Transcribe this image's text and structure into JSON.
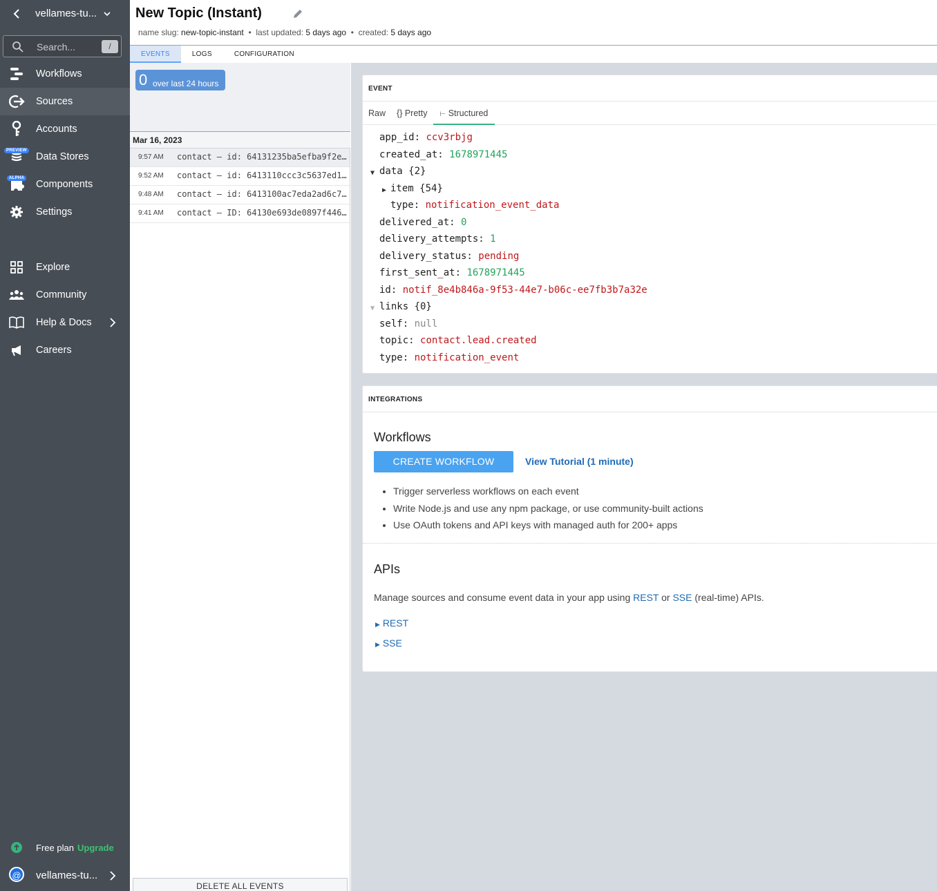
{
  "workspace": {
    "name": "vellames-tu..."
  },
  "search": {
    "placeholder": "Search...",
    "shortcut": "/"
  },
  "sidebar": {
    "items": [
      {
        "label": "Workflows",
        "icon": "workflows-icon"
      },
      {
        "label": "Sources",
        "icon": "sources-icon",
        "active": true
      },
      {
        "label": "Accounts",
        "icon": "key-icon"
      },
      {
        "label": "Data Stores",
        "icon": "database-icon",
        "badge": "PREVIEW"
      },
      {
        "label": "Components",
        "icon": "puzzle-icon",
        "badge": "ALPHA"
      },
      {
        "label": "Settings",
        "icon": "gear-icon"
      },
      {
        "label": "Explore",
        "icon": "grid-icon"
      },
      {
        "label": "Community",
        "icon": "people-icon"
      },
      {
        "label": "Help & Docs",
        "icon": "book-icon"
      },
      {
        "label": "Careers",
        "icon": "megaphone-icon"
      }
    ],
    "plan_label": "Free plan",
    "upgrade_label": "Upgrade",
    "user_name": "vellames-tu...",
    "user_avatar": "@"
  },
  "header": {
    "title": "New Topic (Instant)",
    "slug_label": "name slug:",
    "slug": "new-topic-instant",
    "updated_label": "last updated:",
    "updated": "5 days ago",
    "created_label": "created:",
    "created": "5 days ago",
    "separator": "•"
  },
  "tabs": [
    "EVENTS",
    "LOGS",
    "CONFIGURATION"
  ],
  "events": {
    "count": "0",
    "count_label": "over last 24 hours",
    "date": "Mar 16, 2023",
    "rows": [
      {
        "time": "9:57 AM",
        "text": "contact – id: 64131235ba5efba9f2e..."
      },
      {
        "time": "9:52 AM",
        "text": "contact – id: 6413110ccc3c5637ed1..."
      },
      {
        "time": "9:48 AM",
        "text": "contact – id: 6413100ac7eda2ad6c7..."
      },
      {
        "time": "9:41 AM",
        "text": "contact – ID: 64130e693de0897f446..."
      }
    ],
    "delete_label": "DELETE ALL EVENTS"
  },
  "event_card": {
    "heading": "EVENT",
    "tabs": [
      "Raw",
      "{} Pretty",
      "Structured"
    ],
    "fields": {
      "app_id": "ccv3rbjg",
      "created_at": "1678971445",
      "data_count": "{2}",
      "item_count": "{54}",
      "data_type": "notification_event_data",
      "delivered_at": "0",
      "delivery_attempts": "1",
      "delivery_status": "pending",
      "first_sent_at": "1678971445",
      "id": "notif_8e4b846a-9f53-44e7-b06c-ee7fb3b7a32e",
      "links_count": "{0}",
      "self": "null",
      "topic": "contact.lead.created",
      "type": "notification_event"
    }
  },
  "integrations": {
    "heading": "INTEGRATIONS",
    "workflows_title": "Workflows",
    "create_label": "CREATE WORKFLOW",
    "tutorial_label": "View Tutorial (1 minute)",
    "bullets": [
      "Trigger serverless workflows on each event",
      "Write Node.js and use any npm package, or use community-built actions",
      "Use OAuth tokens and API keys with managed auth for 200+ apps"
    ],
    "apis_title": "APIs",
    "apis_text_before": "Manage sources and consume event data in your app using ",
    "apis_rest": "REST",
    "apis_or": " or ",
    "apis_sse": "SSE",
    "apis_text_after": " (real-time) APIs.",
    "links": [
      "REST",
      "SSE"
    ]
  },
  "colors": {
    "sidebar_bg": "#474d55",
    "accent": "#4aa3f0",
    "string": "#c0181b",
    "number": "#22a35a",
    "link": "#1f6bb5"
  }
}
